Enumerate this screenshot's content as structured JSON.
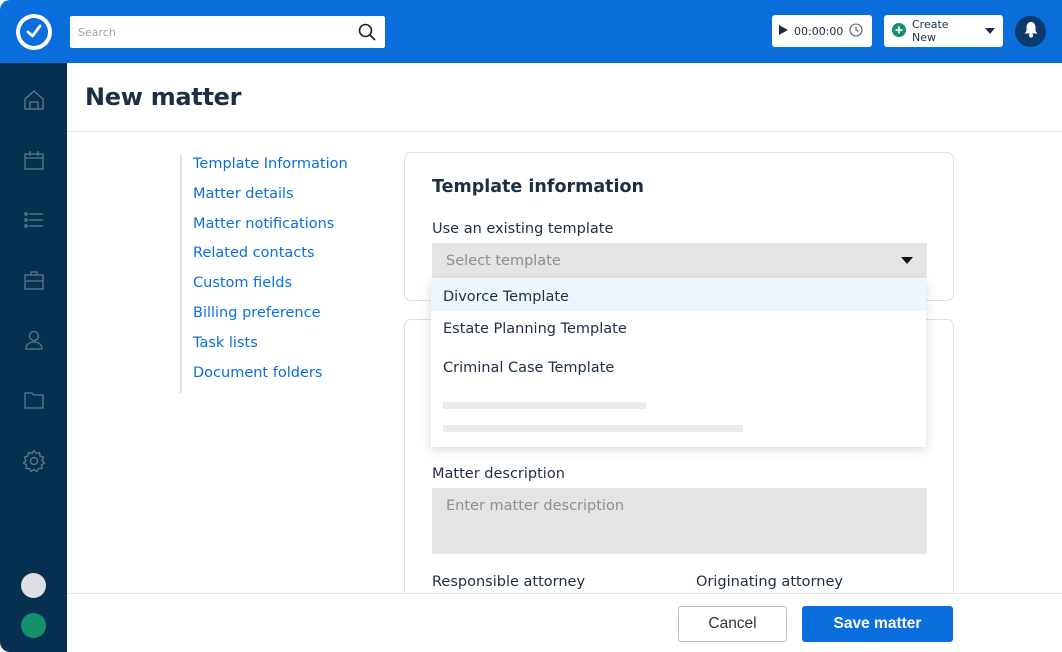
{
  "topbar": {
    "logo_icon": "checkmark-circle-icon",
    "search": {
      "placeholder": "Search",
      "value": "",
      "icon": "search-icon"
    },
    "timer": {
      "play_icon": "play-icon",
      "value": "00:00:00",
      "clock_icon": "clock-icon"
    },
    "create_new": {
      "label": "Create New",
      "icon": "plus-circle-icon",
      "caret_icon": "caret-down-icon",
      "icon_color": "#15906b"
    },
    "notifications_icon": "bell-icon"
  },
  "sidebar": {
    "items": [
      {
        "name": "home",
        "icon": "home-icon"
      },
      {
        "name": "calendar",
        "icon": "calendar-icon"
      },
      {
        "name": "tasks",
        "icon": "list-icon"
      },
      {
        "name": "matters",
        "icon": "briefcase-icon"
      },
      {
        "name": "contacts",
        "icon": "person-icon"
      },
      {
        "name": "documents",
        "icon": "folder-icon"
      },
      {
        "name": "settings",
        "icon": "gear-icon"
      }
    ],
    "avatars": [
      {
        "name": "avatar-gray",
        "color": "#dedfe2"
      },
      {
        "name": "avatar-green",
        "color": "#15906b"
      }
    ]
  },
  "page": {
    "title": "New matter"
  },
  "section_nav": {
    "items": [
      "Template Information",
      "Matter details",
      "Matter notifications",
      "Related contacts",
      "Custom fields",
      "Billing preference",
      "Task lists",
      "Document folders"
    ]
  },
  "template_card": {
    "title": "Template information",
    "field_label": "Use an existing template",
    "select_placeholder": "Select template",
    "options": [
      "Divorce Template",
      "Estate Planning Template",
      "Criminal Case Template"
    ],
    "highlighted_option": "Divorce Template"
  },
  "details_card": {
    "description_label": "Matter description",
    "description_placeholder": "Enter matter description",
    "responsible_label": "Responsible attorney",
    "originating_label": "Originating attorney"
  },
  "footer": {
    "cancel_label": "Cancel",
    "save_label": "Save matter"
  },
  "colors": {
    "brand_blue": "#0a6fdc",
    "sidebar_navy": "#06304f",
    "link_blue": "#0a6fdc",
    "text_dark": "#1c2f44"
  }
}
